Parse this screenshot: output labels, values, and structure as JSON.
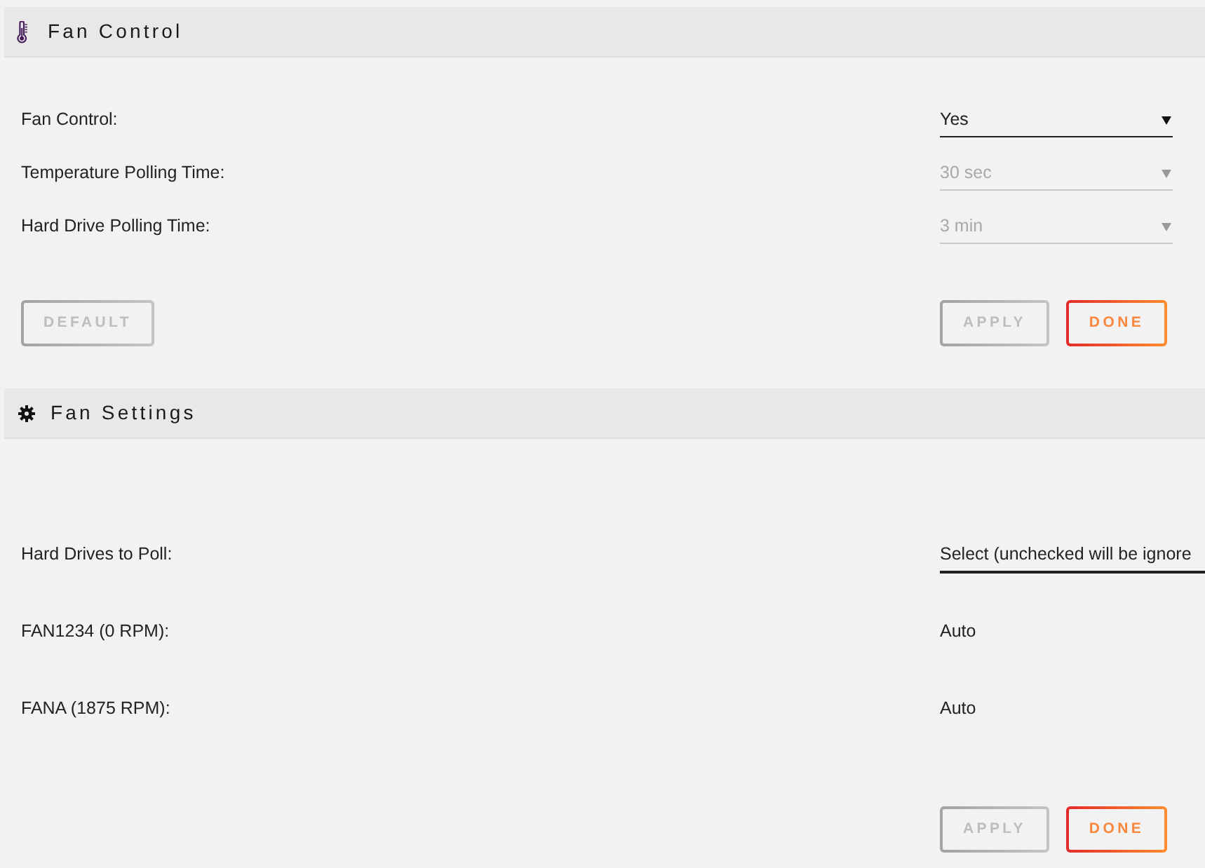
{
  "sections": [
    {
      "title": "Fan Control",
      "fields": [
        {
          "kind": "select",
          "label": "Fan Control:",
          "value": "Yes",
          "disabled": false
        },
        {
          "kind": "select",
          "label": "Temperature Polling Time:",
          "value": "30 sec",
          "disabled": true
        },
        {
          "kind": "select",
          "label": "Hard Drive Polling Time:",
          "value": "3 min",
          "disabled": true
        }
      ],
      "buttons_left": [
        {
          "label": "DEFAULT",
          "disabled": true
        }
      ],
      "buttons_right": [
        {
          "label": "APPLY",
          "disabled": true
        },
        {
          "label": "DONE",
          "disabled": false
        }
      ]
    },
    {
      "title": "Fan Settings",
      "fields": [
        {
          "kind": "multiselect",
          "label": "Hard Drives to Poll:",
          "value": "Select (unchecked will be ignore",
          "disabled": false
        },
        {
          "kind": "text",
          "label": "FAN1234 (0 RPM):",
          "value": "Auto"
        },
        {
          "kind": "text",
          "label": "FANA (1875 RPM):",
          "value": "Auto"
        }
      ],
      "buttons_right": [
        {
          "label": "APPLY",
          "disabled": true
        },
        {
          "label": "DONE",
          "disabled": false
        }
      ]
    }
  ]
}
